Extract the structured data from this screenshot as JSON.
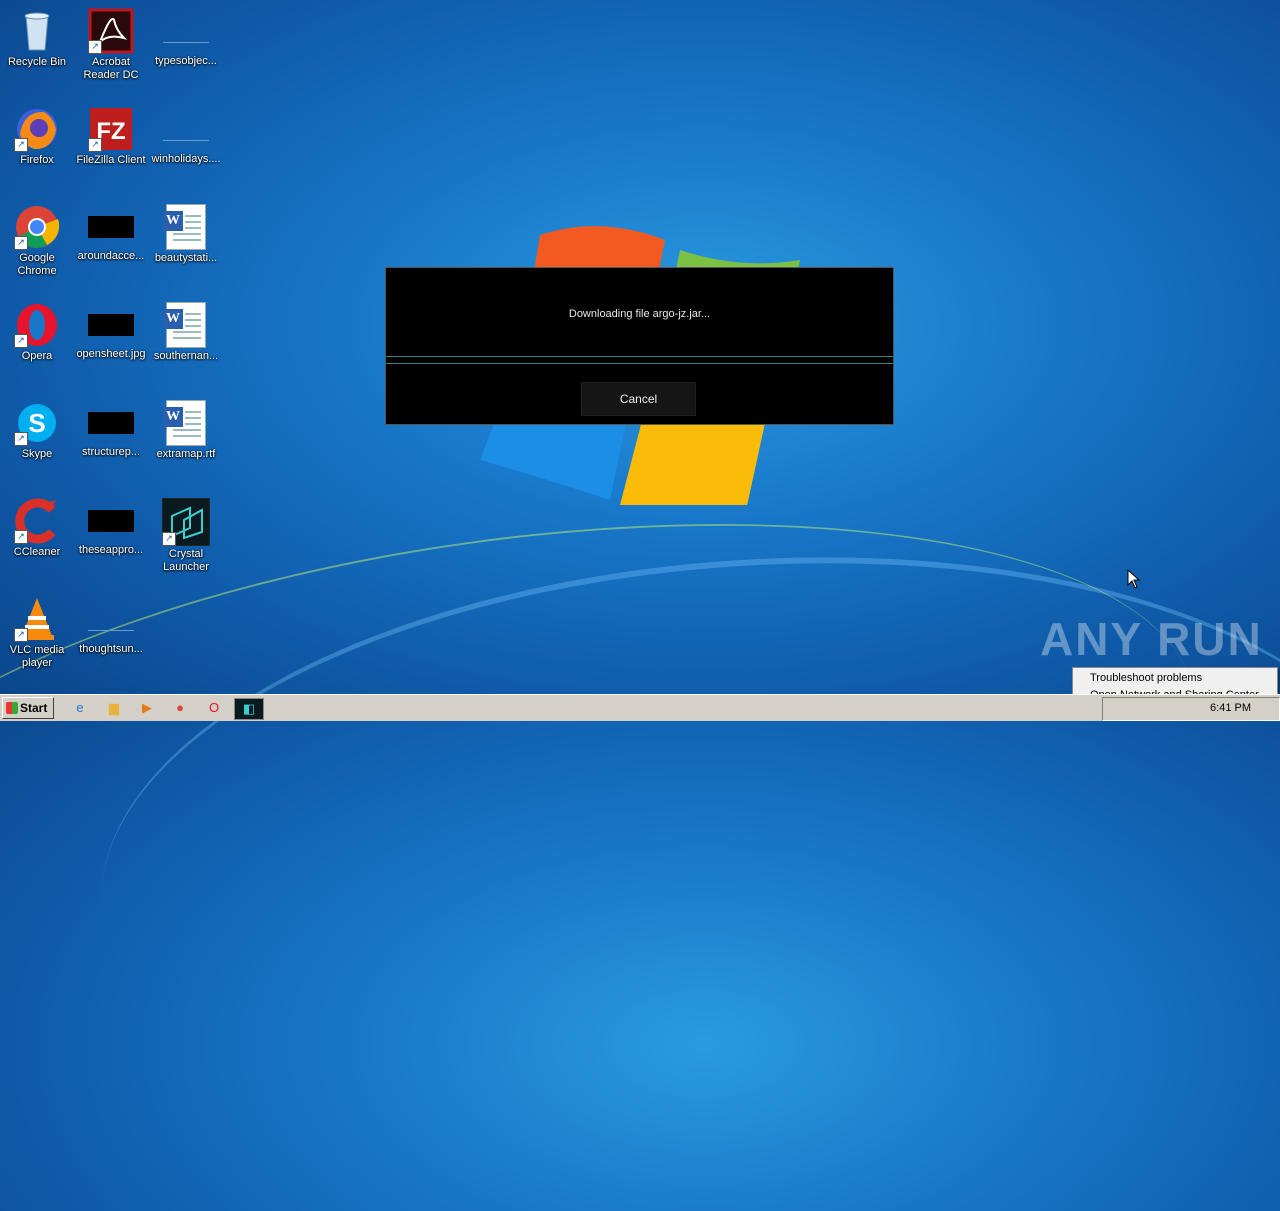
{
  "desktop_icons": [
    {
      "label": "Recycle Bin",
      "icon": "recycle-bin-icon",
      "glyph": "🗑"
    },
    {
      "label": "Acrobat Reader DC",
      "icon": "acrobat-icon",
      "glyph": "A"
    },
    {
      "label": "typesobjec...",
      "icon": "blank-file-icon"
    },
    {
      "label": "Firefox",
      "icon": "firefox-icon",
      "glyph": "🦊"
    },
    {
      "label": "FileZilla Client",
      "icon": "filezilla-icon",
      "glyph": "FZ"
    },
    {
      "label": "winholidays....",
      "icon": "blank-file-icon"
    },
    {
      "label": "Google Chrome",
      "icon": "chrome-icon"
    },
    {
      "label": "aroundacce...",
      "icon": "black-image-icon"
    },
    {
      "label": "beautystati...",
      "icon": "word-doc-icon"
    },
    {
      "label": "Opera",
      "icon": "opera-icon",
      "glyph": "O"
    },
    {
      "label": "opensheet.jpg",
      "icon": "black-image-icon"
    },
    {
      "label": "southernan...",
      "icon": "word-doc-icon"
    },
    {
      "label": "Skype",
      "icon": "skype-icon",
      "glyph": "S"
    },
    {
      "label": "structurep...",
      "icon": "black-image-icon"
    },
    {
      "label": "extramap.rtf",
      "icon": "word-doc-icon"
    },
    {
      "label": "CCleaner",
      "icon": "ccleaner-icon",
      "glyph": "C"
    },
    {
      "label": "theseappro...",
      "icon": "black-image-icon"
    },
    {
      "label": "Crystal Launcher",
      "icon": "crystal-launcher-icon"
    },
    {
      "label": "VLC media player",
      "icon": "vlc-icon"
    },
    {
      "label": "thoughtsun...",
      "icon": "blank-file-icon"
    }
  ],
  "dialog": {
    "message": "Downloading file argo-jz.jar...",
    "progress": 0,
    "cancel_label": "Cancel"
  },
  "watermark": "ANY RUN",
  "context_menu": {
    "items": [
      "Troubleshoot problems",
      "Open Network and Sharing Center"
    ]
  },
  "taskbar": {
    "start_label": "Start",
    "clock": "6:41 PM"
  },
  "colors": {
    "desktop": "#1877c9",
    "dialog_bg": "#000000",
    "progress_line": "#2a8a8a",
    "taskbar": "#d4d0c8"
  }
}
